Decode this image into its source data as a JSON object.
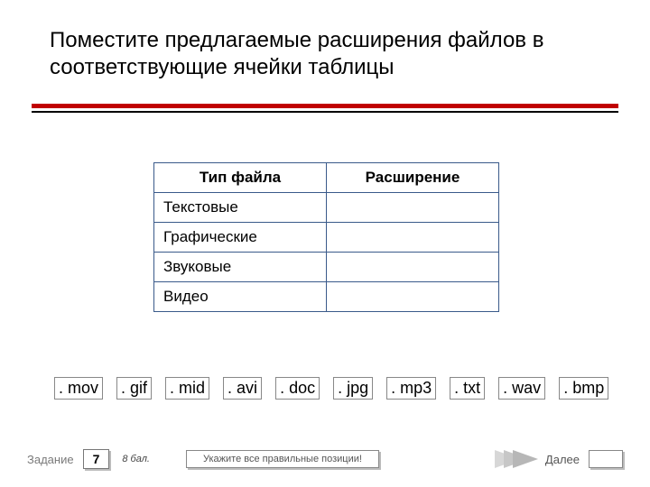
{
  "title": "Поместите предлагаемые расширения файлов в соответствующие ячейки таблицы",
  "table": {
    "headers": {
      "type": "Тип файла",
      "ext": "Расширение"
    },
    "rows": [
      {
        "type": "Текстовые",
        "ext": ""
      },
      {
        "type": "Графические",
        "ext": ""
      },
      {
        "type": "Звуковые",
        "ext": ""
      },
      {
        "type": "Видео",
        "ext": ""
      }
    ]
  },
  "chips": [
    ". mov",
    ". gif",
    ". mid",
    ". avi",
    ". doc",
    ". jpg",
    ". mp3",
    ". txt",
    ". wav",
    ". bmp"
  ],
  "footer": {
    "task_label": "Задание",
    "task_num": "7",
    "points": "8 бал.",
    "instruction": "Укажите все правильные позиции!",
    "next": "Далее"
  }
}
